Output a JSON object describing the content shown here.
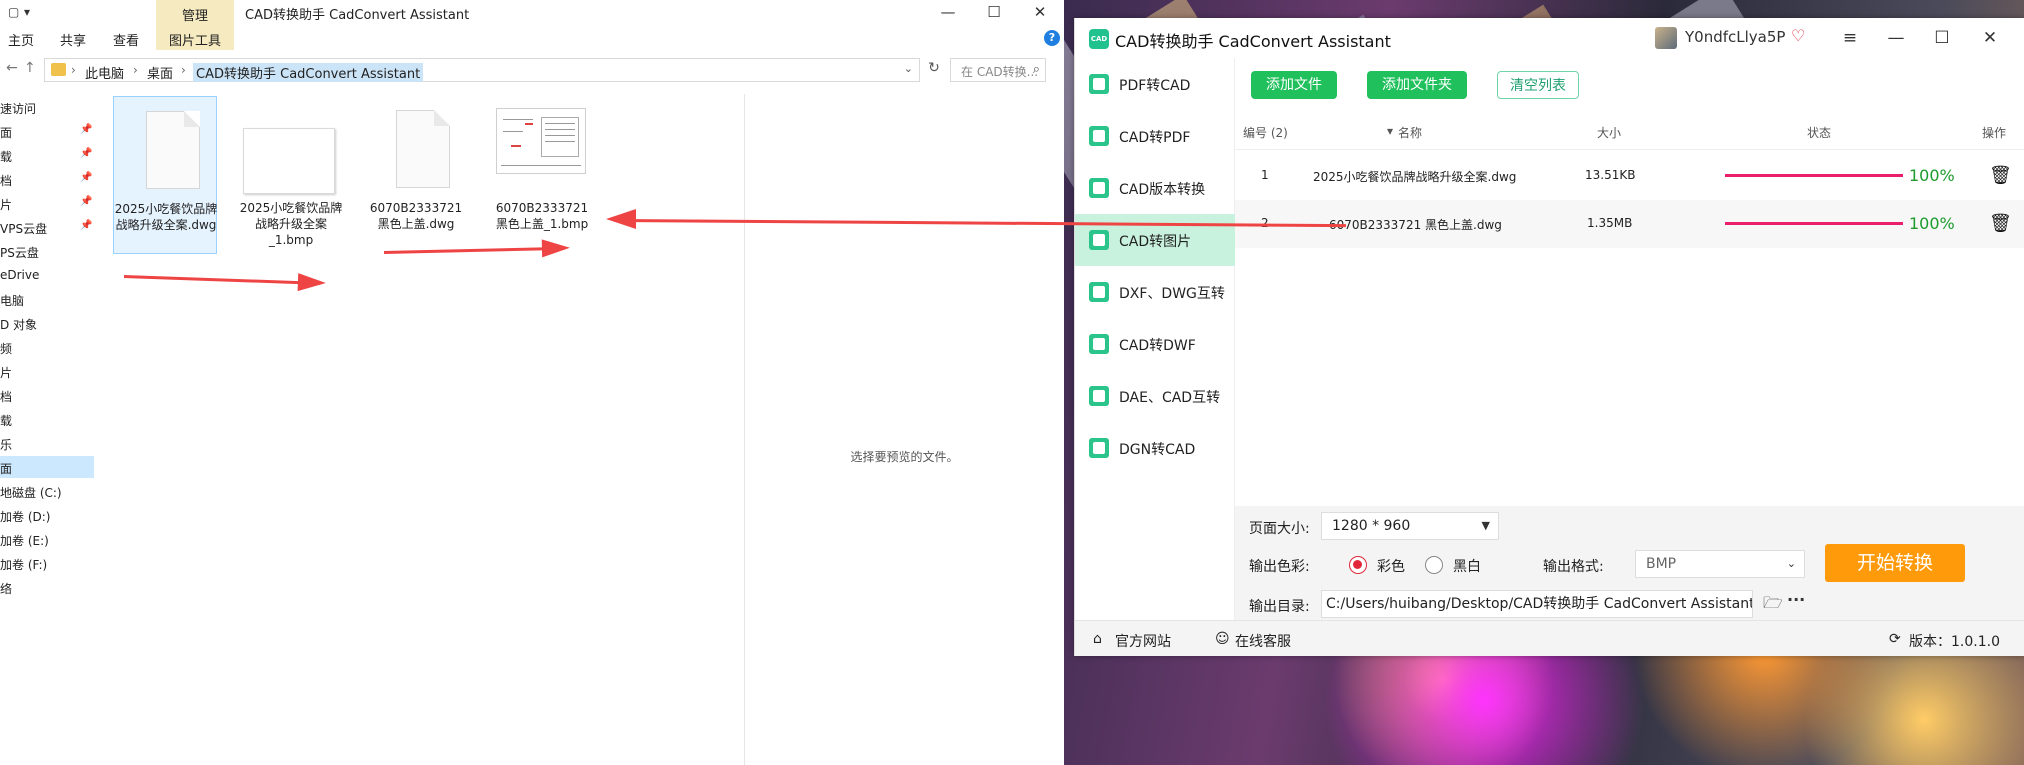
{
  "explorer": {
    "quick_access": [
      "▾"
    ],
    "tabs": {
      "home": "主页",
      "share": "共享",
      "view": "查看",
      "manage": "管理",
      "picture_tools": "图片工具"
    },
    "window_title": "CAD转换助手 CadConvert Assistant",
    "window_buttons": {
      "minimize": "—",
      "maximize": "☐",
      "close": "✕"
    },
    "breadcrumb": [
      "此电脑",
      "桌面",
      "CAD转换助手 CadConvert Assistant"
    ],
    "search_placeholder": "在 CAD转换...",
    "nav_items": [
      {
        "label": "速访问",
        "pinned": false
      },
      {
        "label": "面",
        "pinned": true
      },
      {
        "label": "载",
        "pinned": true
      },
      {
        "label": "档",
        "pinned": true
      },
      {
        "label": "片",
        "pinned": true
      },
      {
        "label": "VPS云盘",
        "pinned": true
      },
      {
        "label": "PS云盘",
        "pinned": false
      },
      {
        "label": "eDrive",
        "pinned": false
      },
      {
        "label": "电脑",
        "pinned": false
      },
      {
        "label": "D 对象",
        "pinned": false
      },
      {
        "label": "频",
        "pinned": false
      },
      {
        "label": "片",
        "pinned": false
      },
      {
        "label": "档",
        "pinned": false
      },
      {
        "label": "载",
        "pinned": false
      },
      {
        "label": "乐",
        "pinned": false
      },
      {
        "label": "面",
        "pinned": false,
        "selected": true
      },
      {
        "label": "地磁盘 (C:)",
        "pinned": false
      },
      {
        "label": "加卷 (D:)",
        "pinned": false
      },
      {
        "label": "加卷 (E:)",
        "pinned": false
      },
      {
        "label": "加卷 (F:)",
        "pinned": false
      },
      {
        "label": "络",
        "pinned": false
      }
    ],
    "files": [
      {
        "name": "2025小吃餐饮品牌战略升级全案.dwg",
        "kind": "dwg",
        "selected": true
      },
      {
        "name": "2025小吃餐饮品牌战略升级全案_1.bmp",
        "kind": "bmp-blank"
      },
      {
        "name": "6070B2333721 黑色上盖.dwg",
        "kind": "dwg"
      },
      {
        "name": "6070B2333721 黑色上盖_1.bmp",
        "kind": "bmp-drawing"
      }
    ],
    "preview_text": "选择要预览的文件。"
  },
  "cad": {
    "logo_text": "CAD",
    "title": "CAD转换助手 CadConvert Assistant",
    "user_name": "Y0ndfcLlya5P",
    "vip_icon": "heart-diamond-icon",
    "window_buttons": {
      "menu": "≡",
      "minimize": "—",
      "maximize": "☐",
      "close": "✕"
    },
    "sidebar": [
      {
        "label": "PDF转CAD"
      },
      {
        "label": "CAD转PDF"
      },
      {
        "label": "CAD版本转换"
      },
      {
        "label": "CAD转图片",
        "selected": true
      },
      {
        "label": "DXF、DWG互转"
      },
      {
        "label": "CAD转DWF"
      },
      {
        "label": "DAE、CAD互转"
      },
      {
        "label": "DGN转CAD"
      }
    ],
    "toolbar": {
      "add_file": "添加文件",
      "add_folder": "添加文件夹",
      "clear_list": "清空列表"
    },
    "table": {
      "headers": {
        "index": "编号 (2)",
        "name": "名称",
        "size": "大小",
        "status": "状态",
        "action": "操作"
      },
      "rows": [
        {
          "index": "1",
          "name": "2025小吃餐饮品牌战略升级全案.dwg",
          "size": "13.51KB",
          "progress": 100,
          "progress_text": "100%"
        },
        {
          "index": "2",
          "name": "6070B2333721 黑色上盖.dwg",
          "size": "1.35MB",
          "progress": 100,
          "progress_text": "100%"
        }
      ]
    },
    "settings": {
      "page_size_label": "页面大小:",
      "page_size_value": "1280 * 960",
      "color_label": "输出色彩:",
      "color_options": [
        {
          "label": "彩色",
          "checked": true
        },
        {
          "label": "黑白",
          "checked": false
        }
      ],
      "format_label": "输出格式:",
      "format_value": "BMP",
      "start_button": "开始转换",
      "output_dir_label": "输出目录:",
      "output_dir_value": "C:/Users/huibang/Desktop/CAD转换助手 CadConvert Assistant"
    },
    "footer": {
      "website": "官方网站",
      "support": "在线客服",
      "version": "版本：1.0.1.0"
    },
    "colors": {
      "accent_green": "#20c05c",
      "progress": "#ea1e6a",
      "percent_text": "#1c9b2c",
      "start_button": "#ff9a0a",
      "selected_side": "#c9f2de"
    }
  }
}
